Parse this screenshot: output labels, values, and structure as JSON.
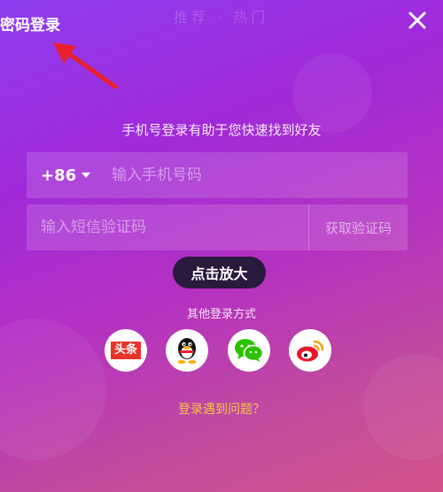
{
  "header": {
    "title": "密码登录",
    "background_text": "推荐 · 热门",
    "close_icon": "close-icon"
  },
  "login": {
    "subtitle": "手机号登录有助于您快速找到好友",
    "country_code": "+86",
    "phone_placeholder": "输入手机号码",
    "code_placeholder": "输入短信验证码",
    "get_code_label": "获取验证码"
  },
  "overlay": {
    "zoom_label": "点击放大"
  },
  "other_login": {
    "label": "其他登录方式",
    "providers": [
      {
        "name": "toutiao",
        "badge_text": "头条",
        "icon": "toutiao-icon",
        "color": "#e8332a"
      },
      {
        "name": "qq",
        "icon": "qq-penguin-icon",
        "color": "#111111"
      },
      {
        "name": "wechat",
        "icon": "wechat-icon",
        "color": "#2dc100"
      },
      {
        "name": "weibo",
        "icon": "weibo-icon",
        "color": "#e6162d"
      }
    ]
  },
  "help": {
    "link_text": "登录遇到问题？"
  },
  "colors": {
    "accent_link": "#f5c542",
    "annotation_arrow": "#e8202a",
    "pill_bg": "#2a1a3d"
  }
}
